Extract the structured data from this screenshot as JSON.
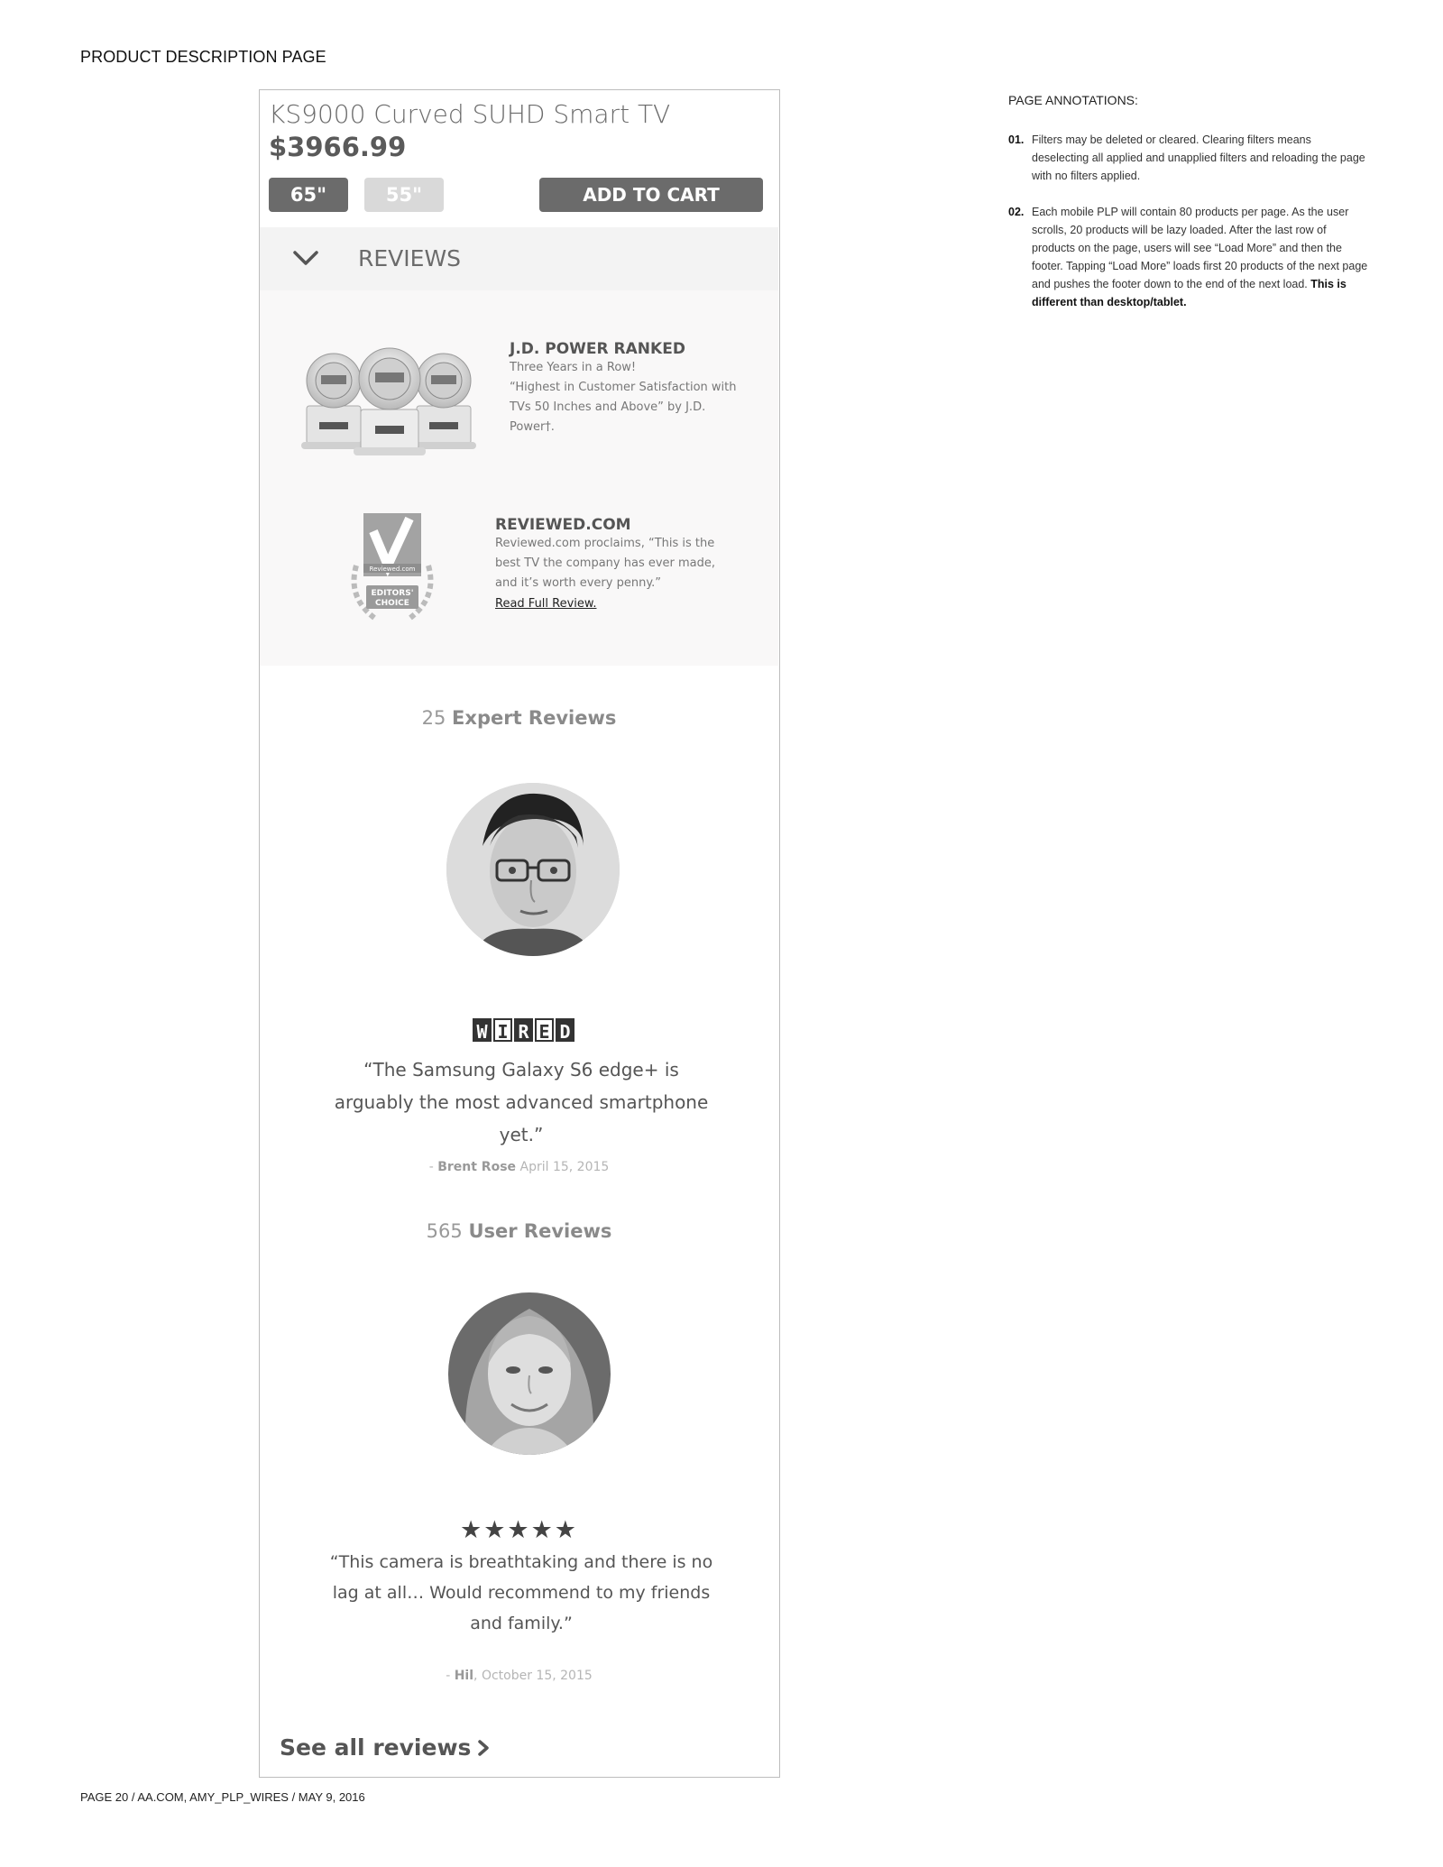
{
  "page": {
    "label": "PRODUCT DESCRIPTION PAGE",
    "footer": "PAGE 20  /  AA.COM, AMY_PLP_WIRES / MAY 9, 2016"
  },
  "product": {
    "title": "KS9000 Curved SUHD Smart TV",
    "price": "$3966.99",
    "sizes": [
      {
        "label": "65\"",
        "selected": true
      },
      {
        "label": "55\"",
        "selected": false
      }
    ],
    "cart_label": "ADD TO CART"
  },
  "reviews_section": {
    "label": "REVIEWS",
    "icon": "chevron-down-icon"
  },
  "awards": {
    "jd_power": {
      "title": "J.D. POWER RANKED",
      "line1": "Three Years in a Row!",
      "line2": "“Highest in Customer Satisfaction with TVs 50 Inches and Above” by J.D. Power†."
    },
    "reviewed": {
      "title": "REVIEWED.COM",
      "text": "Reviewed.com proclaims, “This is the best TV the company has ever made, and it’s worth every penny.”",
      "link": "Read Full Review.",
      "badge_brand": "Reviewed.com",
      "badge_line1": "EDITORS'",
      "badge_line2": "CHOICE"
    }
  },
  "expert_reviews": {
    "count": "25",
    "label": "Expert Reviews",
    "source_logo_letters": [
      "W",
      "I",
      "R",
      "E",
      "D"
    ],
    "quote": "“The Samsung Galaxy S6 edge+ is arguably the most advanced smartphone yet.”",
    "author_prefix": "- ",
    "author": "Brent Rose",
    "date": " April 15, 2015"
  },
  "user_reviews": {
    "count": "565",
    "label": "User Reviews",
    "rating": 5,
    "stars": "★★★★★",
    "quote": "“This camera is breathtaking and there is no lag at all… Would recommend to my friends and family.”",
    "author_prefix": "- ",
    "author": "Hil",
    "date": ", October 15, 2015"
  },
  "see_all": {
    "label": "See all reviews"
  },
  "annotations": {
    "title": "PAGE ANNOTATIONS:",
    "items": [
      {
        "num": "01.",
        "text": "Filters may be deleted or cleared. Clearing filters means deselecting all applied and unapplied filters and reloading the page with no filters applied.",
        "bold": ""
      },
      {
        "num": "02.",
        "text": "Each mobile PLP will contain 80 products per page. As the user scrolls, 20 products will be lazy loaded. After the last row of products on the page, users will see “Load More” and then the footer. Tapping “Load More” loads first 20 products of the next page and pushes the footer down to the end of the next load. ",
        "bold": "This is different than desktop/tablet."
      }
    ]
  }
}
